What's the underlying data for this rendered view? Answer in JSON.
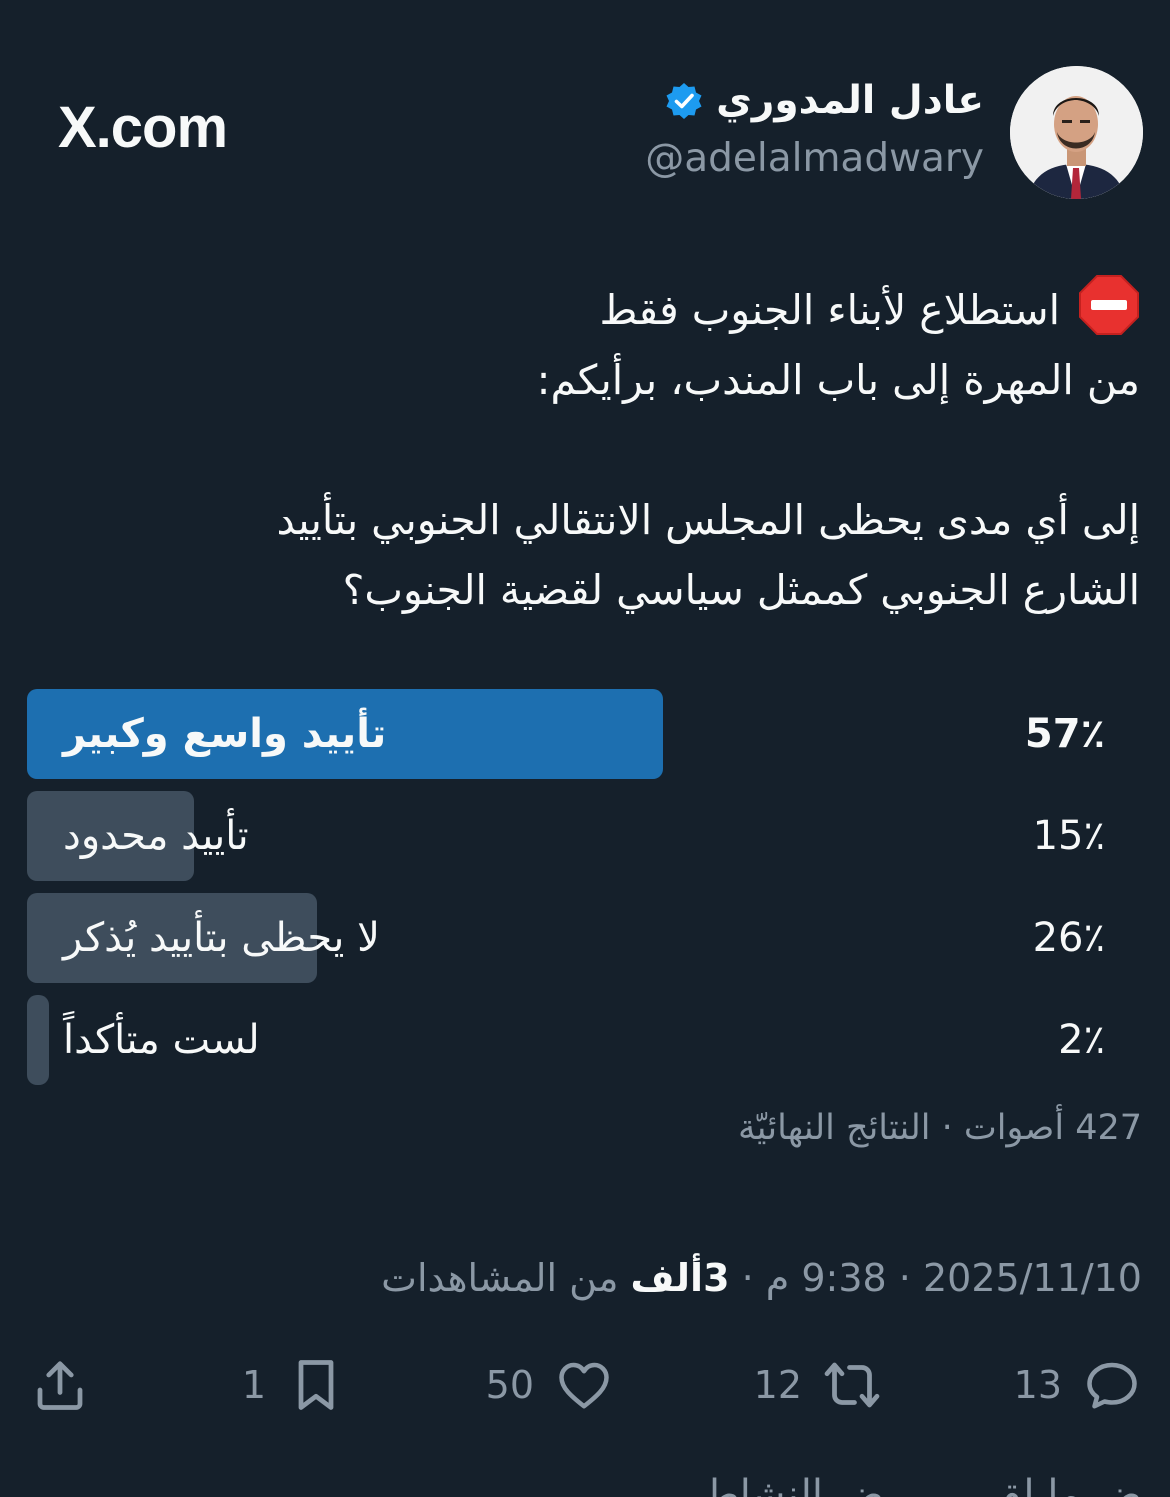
{
  "author": {
    "name": "عادل المدوري",
    "handle": "@adelalmadwary",
    "verified": true
  },
  "brand": "X.com",
  "tweet": {
    "lines": [
      "استطلاع لأبناء الجنوب فقط",
      "من المهرة إلى باب المندب، برأيكم:",
      "إلى أي مدى يحظى المجلس الانتقالي الجنوبي بتأييد",
      "الشارع الجنوبي كممثل سياسي لقضية الجنوب؟"
    ]
  },
  "poll": {
    "options": [
      {
        "label": "تأييد واسع وكبير",
        "percent_text": "57٪",
        "percent": 57,
        "winner": true
      },
      {
        "label": "تأييد محدود",
        "percent_text": "15٪",
        "percent": 15,
        "winner": false
      },
      {
        "label": "لا يحظى بتأييد يُذكر",
        "percent_text": "26٪",
        "percent": 26,
        "winner": false
      },
      {
        "label": "لست متأكداً",
        "percent_text": "2٪",
        "percent": 2,
        "winner": false
      }
    ],
    "summary": "427 أصوات · النتائج النهائيّة"
  },
  "meta": {
    "date_time": "2025/11/10 · 9:38 م · ",
    "views_count": "3ألف",
    "views_suffix": " من المشاهدات"
  },
  "actions": {
    "replies": "13",
    "reposts": "12",
    "likes": "50",
    "bookmarks": "1"
  },
  "cut_text": "ض ما لقي … رض النشاط",
  "colors": {
    "background": "#15202b",
    "winner_bar": "#1d6fb0",
    "bar": "#3e4d5c",
    "muted_text": "#8b98a5",
    "verified_badge": "#1d9bf0"
  }
}
